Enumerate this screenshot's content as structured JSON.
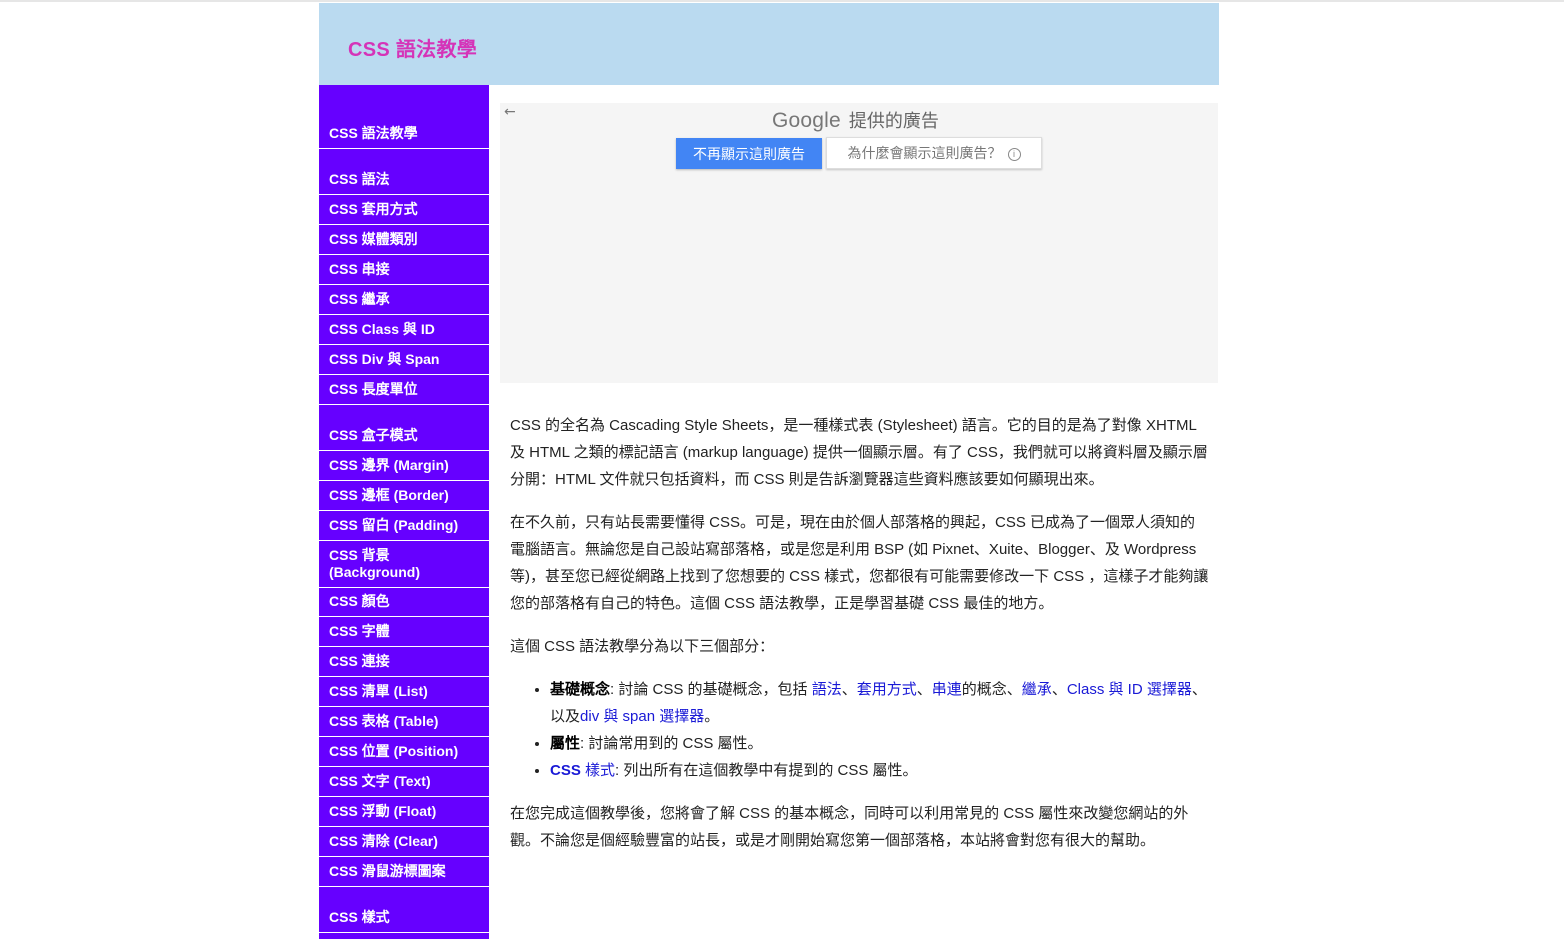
{
  "header": {
    "title": "CSS 語法教學"
  },
  "sidebar": {
    "items": [
      {
        "label": "CSS 語法教學"
      },
      {
        "label": "CSS 語法"
      },
      {
        "label": "CSS 套用方式"
      },
      {
        "label": "CSS 媒體類別"
      },
      {
        "label": "CSS 串接"
      },
      {
        "label": "CSS 繼承"
      },
      {
        "label": "CSS Class 與 ID"
      },
      {
        "label": "CSS Div 與 Span"
      },
      {
        "label": "CSS 長度單位"
      },
      {
        "label": "CSS 盒子模式"
      },
      {
        "label": "CSS 邊界 (Margin)"
      },
      {
        "label": "CSS 邊框 (Border)"
      },
      {
        "label": "CSS 留白 (Padding)"
      },
      {
        "label": "CSS 背景 (Background)"
      },
      {
        "label": "CSS 顏色"
      },
      {
        "label": "CSS 字體"
      },
      {
        "label": "CSS 連接"
      },
      {
        "label": "CSS 清單 (List)"
      },
      {
        "label": "CSS 表格 (Table)"
      },
      {
        "label": "CSS 位置 (Position)"
      },
      {
        "label": "CSS 文字 (Text)"
      },
      {
        "label": "CSS 浮動 (Float)"
      },
      {
        "label": "CSS 清除 (Clear)"
      },
      {
        "label": "CSS 滑鼠游標圖案"
      },
      {
        "label": "CSS 樣式"
      }
    ]
  },
  "ad": {
    "back_icon": "←",
    "provider_brand": "Google",
    "provider_text": "提供的廣告",
    "stop_button": "不再顯示這則廣告",
    "why_button": "為什麼會顯示這則廣告？",
    "info_icon": "i"
  },
  "article": {
    "p1": "CSS 的全名為 Cascading Style Sheets，是一種樣式表 (Stylesheet) 語言。它的目的是為了對像 XHTML 及 HTML 之類的標記語言 (markup language) 提供一個顯示層。有了 CSS，我們就可以將資料層及顯示層分開：HTML 文件就只包括資料，而 CSS 則是告訴瀏覽器這些資料應該要如何顯現出來。",
    "p2": "在不久前，只有站長需要懂得 CSS。可是，現在由於個人部落格的興起，CSS 已成為了一個眾人須知的電腦語言。無論您是自己設站寫部落格，或是您是利用 BSP (如 Pixnet、Xuite、Blogger、及 Wordpress 等)，甚至您已經從網路上找到了您想要的 CSS 樣式，您都很有可能需要修改一下 CSS ，這樣子才能夠讓您的部落格有自己的特色。這個 CSS 語法教學，正是學習基礎 CSS 最佳的地方。",
    "p3": "這個 CSS 語法教學分為以下三個部分：",
    "list": {
      "i1_term": "基礎概念",
      "i1_pre": ": 討論 CSS 的基礎概念，包括 ",
      "i1_link1": "語法",
      "i1_sep1": "、",
      "i1_link2": "套用方式",
      "i1_sep2": "、",
      "i1_link3": "串連",
      "i1_mid": "的概念、",
      "i1_link4": "繼承",
      "i1_sep3": "、",
      "i1_link5": "Class 與 ID 選擇器",
      "i1_mid2": "、以及",
      "i1_link6": "div 與 span 選擇器",
      "i1_end": "。",
      "i2_term": "屬性",
      "i2_text": ": 討論常用到的 CSS 屬性。",
      "i3_link_bold": "CSS",
      "i3_link": " 樣式",
      "i3_text": ": 列出所有在這個教學中有提到的 CSS 屬性。"
    },
    "p4": "在您完成這個教學後，您將會了解 CSS 的基本概念，同時可以利用常見的 CSS 屬性來改變您網站的外觀。不論您是個經驗豐富的站長，或是才剛開始寫您第一個部落格，本站將會對您有很大的幫助。"
  }
}
